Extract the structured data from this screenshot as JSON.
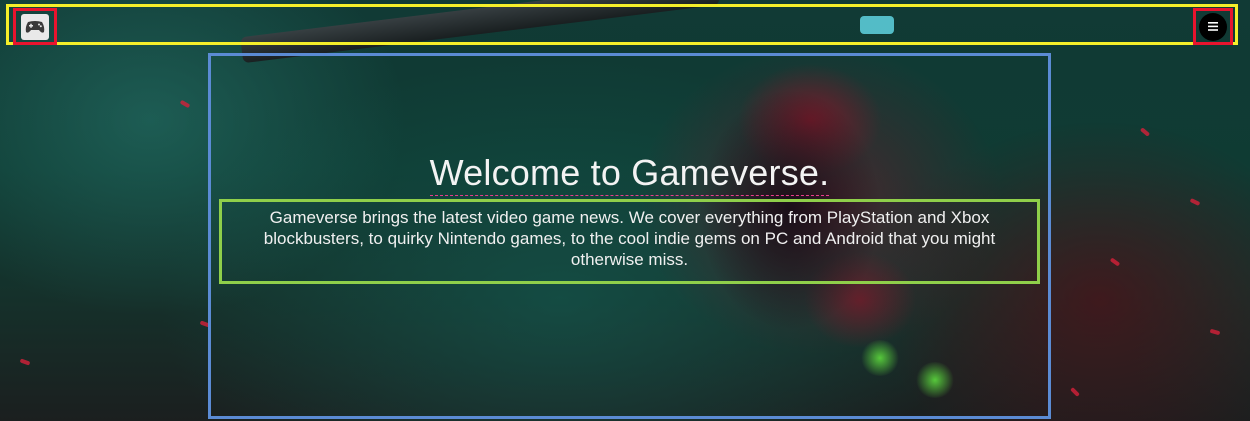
{
  "header": {
    "logo_icon": "gamepad-logo-icon",
    "menu_icon": "hamburger-menu-icon"
  },
  "hero": {
    "title": "Welcome to Gameverse.",
    "description": "Gameverse brings the latest video game news. We cover everything from PlayStation and Xbox blockbusters, to quirky Nintendo games, to the cool indie gems on PC and Android that you might otherwise miss."
  },
  "colors": {
    "navbar_outline": "#f5ef2a",
    "button_outline": "#e8142e",
    "hero_outline": "#5b8bd4",
    "description_outline": "#8fcf4a",
    "title_underline": "#e83c8c"
  }
}
